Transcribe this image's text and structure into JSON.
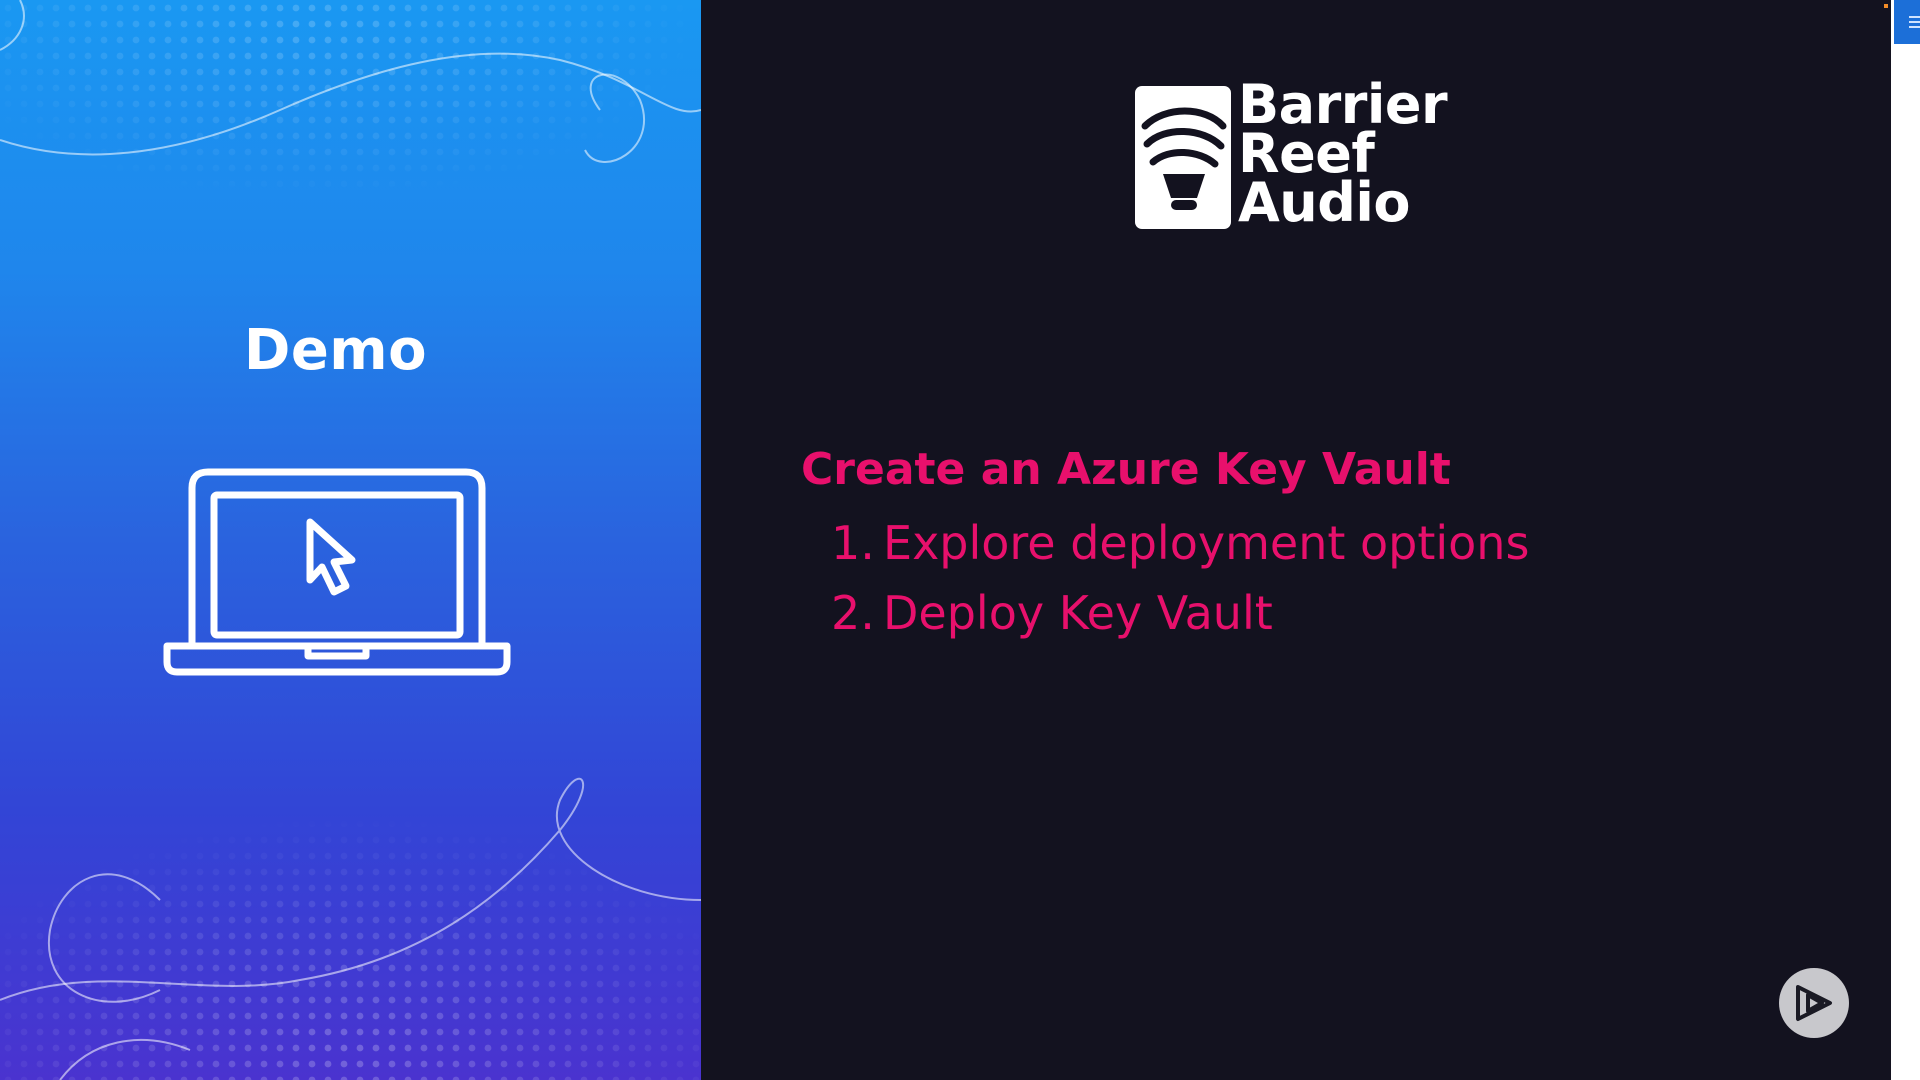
{
  "left_panel": {
    "title": "Demo",
    "icon": "laptop-with-cursor-icon"
  },
  "brand": {
    "logo_icon": "speaker-waves-icon",
    "name_lines": [
      "Barrier",
      "Reef",
      "Audio"
    ]
  },
  "agenda": {
    "heading": "Create an Azure Key Vault",
    "items": [
      {
        "number": "1.",
        "label": "Explore deployment options"
      },
      {
        "number": "2.",
        "label": "Deploy Key Vault"
      }
    ]
  },
  "controls": {
    "play_icon": "play-logo-icon",
    "menu_icon": "hamburger-menu-icon"
  },
  "colors": {
    "accent": "#e8106c",
    "dark_background": "#13121f",
    "gradient_top": "#1a98f2",
    "gradient_bottom": "#4a33cf"
  }
}
